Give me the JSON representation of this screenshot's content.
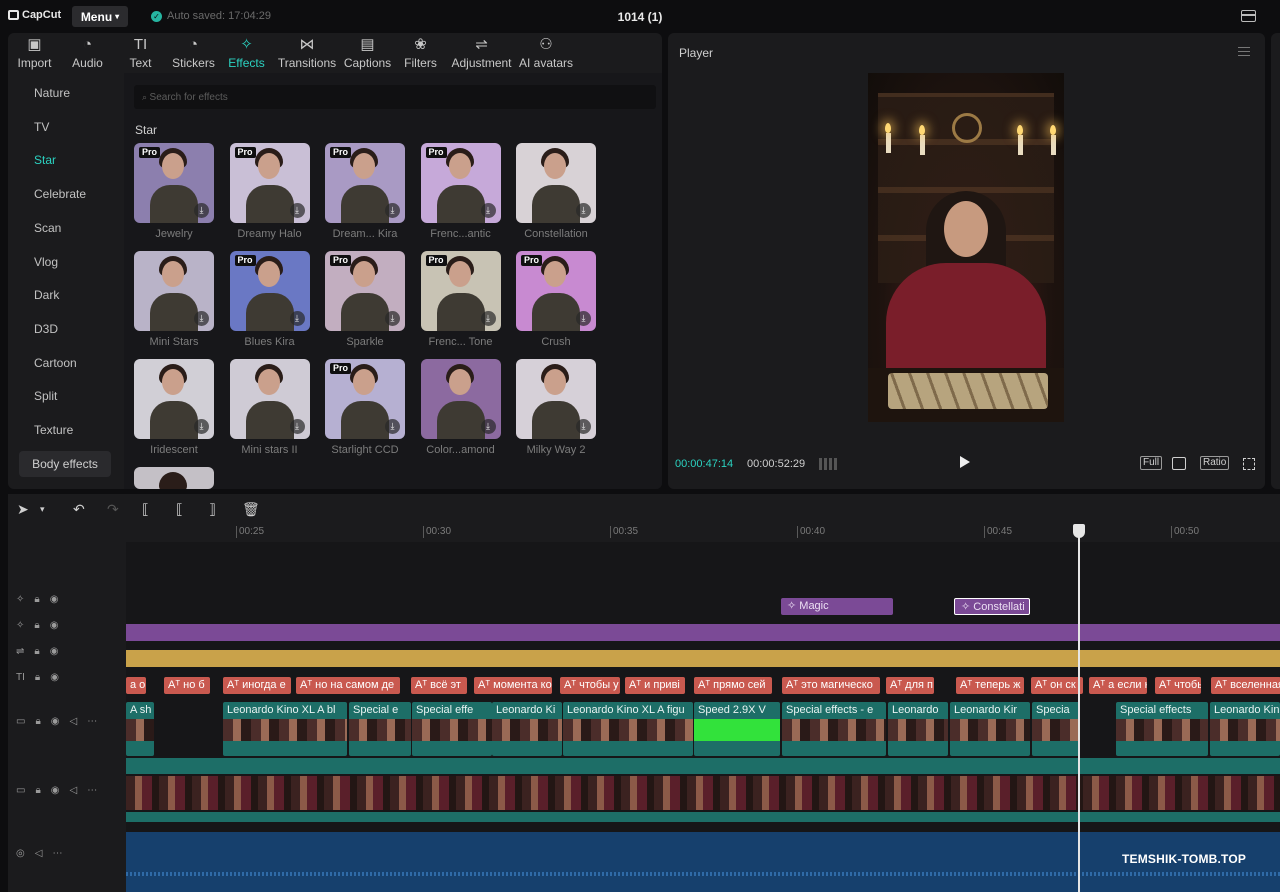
{
  "app": {
    "logo_text": "CapCut",
    "menu_label": "Menu",
    "autosave": "Auto saved: 17:04:29",
    "project_title": "1014 (1)"
  },
  "tabs": [
    {
      "label": "Import",
      "icon": "import-icon"
    },
    {
      "label": "Audio",
      "icon": "audio-icon"
    },
    {
      "label": "Text",
      "icon": "text-icon"
    },
    {
      "label": "Stickers",
      "icon": "stickers-icon"
    },
    {
      "label": "Effects",
      "icon": "effects-icon"
    },
    {
      "label": "Transitions",
      "icon": "transitions-icon"
    },
    {
      "label": "Captions",
      "icon": "captions-icon"
    },
    {
      "label": "Filters",
      "icon": "filters-icon"
    },
    {
      "label": "Adjustment",
      "icon": "adjustment-icon"
    },
    {
      "label": "AI avatars",
      "icon": "ai-avatar-icon"
    }
  ],
  "categories": [
    "Nature",
    "TV",
    "Star",
    "Celebrate",
    "Scan",
    "Vlog",
    "Dark",
    "D3D",
    "Cartoon",
    "Split",
    "Texture"
  ],
  "active_category": "Star",
  "body_effects_label": "Body effects",
  "search_placeholder": "Search for effects",
  "section_title": "Star",
  "pro_badge": "Pro",
  "effects": [
    {
      "name": "Jewelry",
      "pro": true,
      "tint": "#8c7fae"
    },
    {
      "name": "Dreamy Halo",
      "pro": true,
      "tint": "#c9bfd6"
    },
    {
      "name": "Dream... Kira",
      "pro": true,
      "tint": "#a99ac4"
    },
    {
      "name": "Frenc...antic",
      "pro": true,
      "tint": "#c6a9d9"
    },
    {
      "name": "Constellation",
      "pro": false,
      "tint": "#d8d2d6"
    },
    {
      "name": "Mini Stars",
      "pro": false,
      "tint": "#b9b3c8"
    },
    {
      "name": "Blues Kira",
      "pro": true,
      "tint": "#6a78c4"
    },
    {
      "name": "Sparkle",
      "pro": true,
      "tint": "#c2aec0"
    },
    {
      "name": "Frenc... Tone",
      "pro": true,
      "tint": "#c8c3b4"
    },
    {
      "name": "Crush",
      "pro": true,
      "tint": "#c88ad1"
    },
    {
      "name": "Iridescent",
      "pro": false,
      "tint": "#d1cfd6"
    },
    {
      "name": "Mini stars II",
      "pro": false,
      "tint": "#cfcbd5"
    },
    {
      "name": "Starlight CCD",
      "pro": true,
      "tint": "#b6b0d2"
    },
    {
      "name": "Color...amond",
      "pro": false,
      "tint": "#8c6aa0"
    },
    {
      "name": "Milky Way 2",
      "pro": false,
      "tint": "#d6d0d8"
    }
  ],
  "player": {
    "title": "Player",
    "current_time": "00:00:47:14",
    "total_time": "00:00:52:29",
    "btn_full": "Full",
    "btn_ratio": "Ratio"
  },
  "timeline": {
    "ruler": [
      "00:25",
      "00:30",
      "00:35",
      "00:40",
      "00:45",
      "00:50"
    ],
    "effect_clips": [
      "Magic",
      "Constellati"
    ],
    "text_clips": [
      "а он",
      "но б",
      "иногда е",
      "но на самом де",
      "всё эт",
      "момента ко",
      "чтобы у",
      "и приві",
      "прямо сей",
      "это магическо",
      "для п",
      "теперь ж",
      "он ск",
      "а если н",
      "чтобь",
      "вселенная"
    ],
    "video_clips": [
      "A sh",
      "Leonardo Kino XL A bl",
      "Special e",
      "Special effe",
      "Leonardo Ki",
      "Leonardo Kino XL A figu",
      "Speed 2.9X V",
      "Special effects - e",
      "Leonardo",
      "Leonardo Kir",
      "Specia",
      "Special effects",
      "Leonardo Kin"
    ]
  },
  "watermark": "TEMSHIK-TOMB.TOP",
  "colors": {
    "accent": "#2bd2c1",
    "effect_track": "#7b4a96",
    "adjust_track": "#c9a24a",
    "text_clip": "#c9594f",
    "video_clip": "#1d6e67",
    "audio": "#16406d"
  }
}
